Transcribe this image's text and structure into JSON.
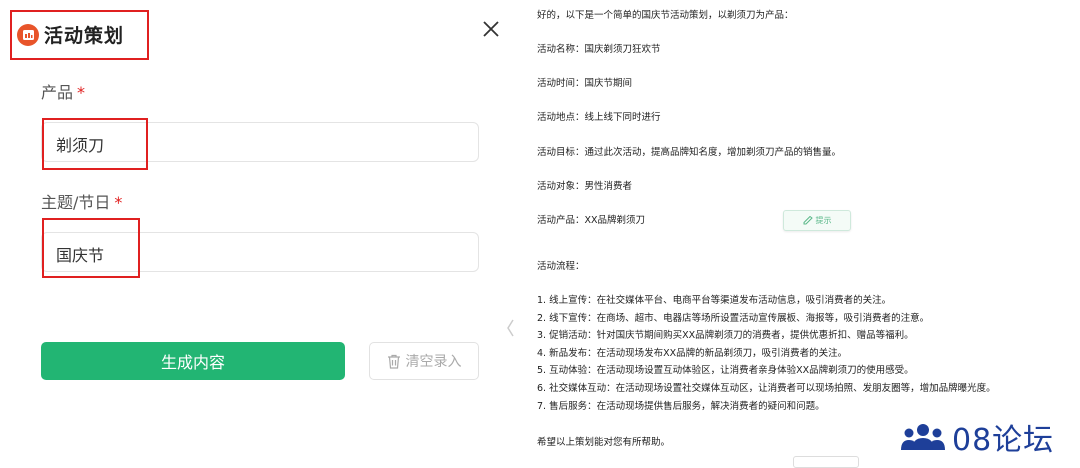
{
  "app": {
    "title": "活动策划",
    "icon": "calendar-icon",
    "accent": "#e8542a"
  },
  "form": {
    "product_label": "产品",
    "product_required": "*",
    "product_value": "剃须刀",
    "theme_label": "主题/节日",
    "theme_required": "*",
    "theme_value": "国庆节"
  },
  "buttons": {
    "generate": "生成内容",
    "generate_color": "#22b573",
    "clear": "清空录入"
  },
  "result": {
    "lines": [
      "好的，以下是一个简单的国庆节活动策划，以剃须刀为产品：",
      "活动名称：国庆剃须刀狂欢节",
      "活动时间：国庆节期间",
      "活动地点：线上线下同时进行",
      "活动目标：通过此次活动，提高品牌知名度，增加剃须刀产品的销售量。",
      "活动对象：男性消费者",
      "活动产品：XX品牌剃须刀",
      "活动流程：",
      "1. 线上宣传：在社交媒体平台、电商平台等渠道发布活动信息，吸引消费者的关注。",
      "2. 线下宣传：在商场、超市、电器店等场所设置活动宣传展板、海报等，吸引消费者的注意。",
      "3. 促销活动：针对国庆节期间购买XX品牌剃须刀的消费者，提供优惠折扣、赠品等福利。",
      "4. 新品发布：在活动现场发布XX品牌的新品剃须刀，吸引消费者的关注。",
      "5. 互动体验：在活动现场设置互动体验区，让消费者亲身体验XX品牌剃须刀的使用感受。",
      "6. 社交媒体互动：在活动现场设置社交媒体互动区，让消费者可以现场拍照、发朋友圈等，增加品牌曝光度。",
      "7. 售后服务：在活动现场提供售后服务，解决消费者的疑问和问题。",
      "希望以上策划能对您有所帮助。"
    ],
    "chip_label": "提示"
  },
  "watermark": {
    "text": "08论坛",
    "color": "#1e3f99"
  }
}
